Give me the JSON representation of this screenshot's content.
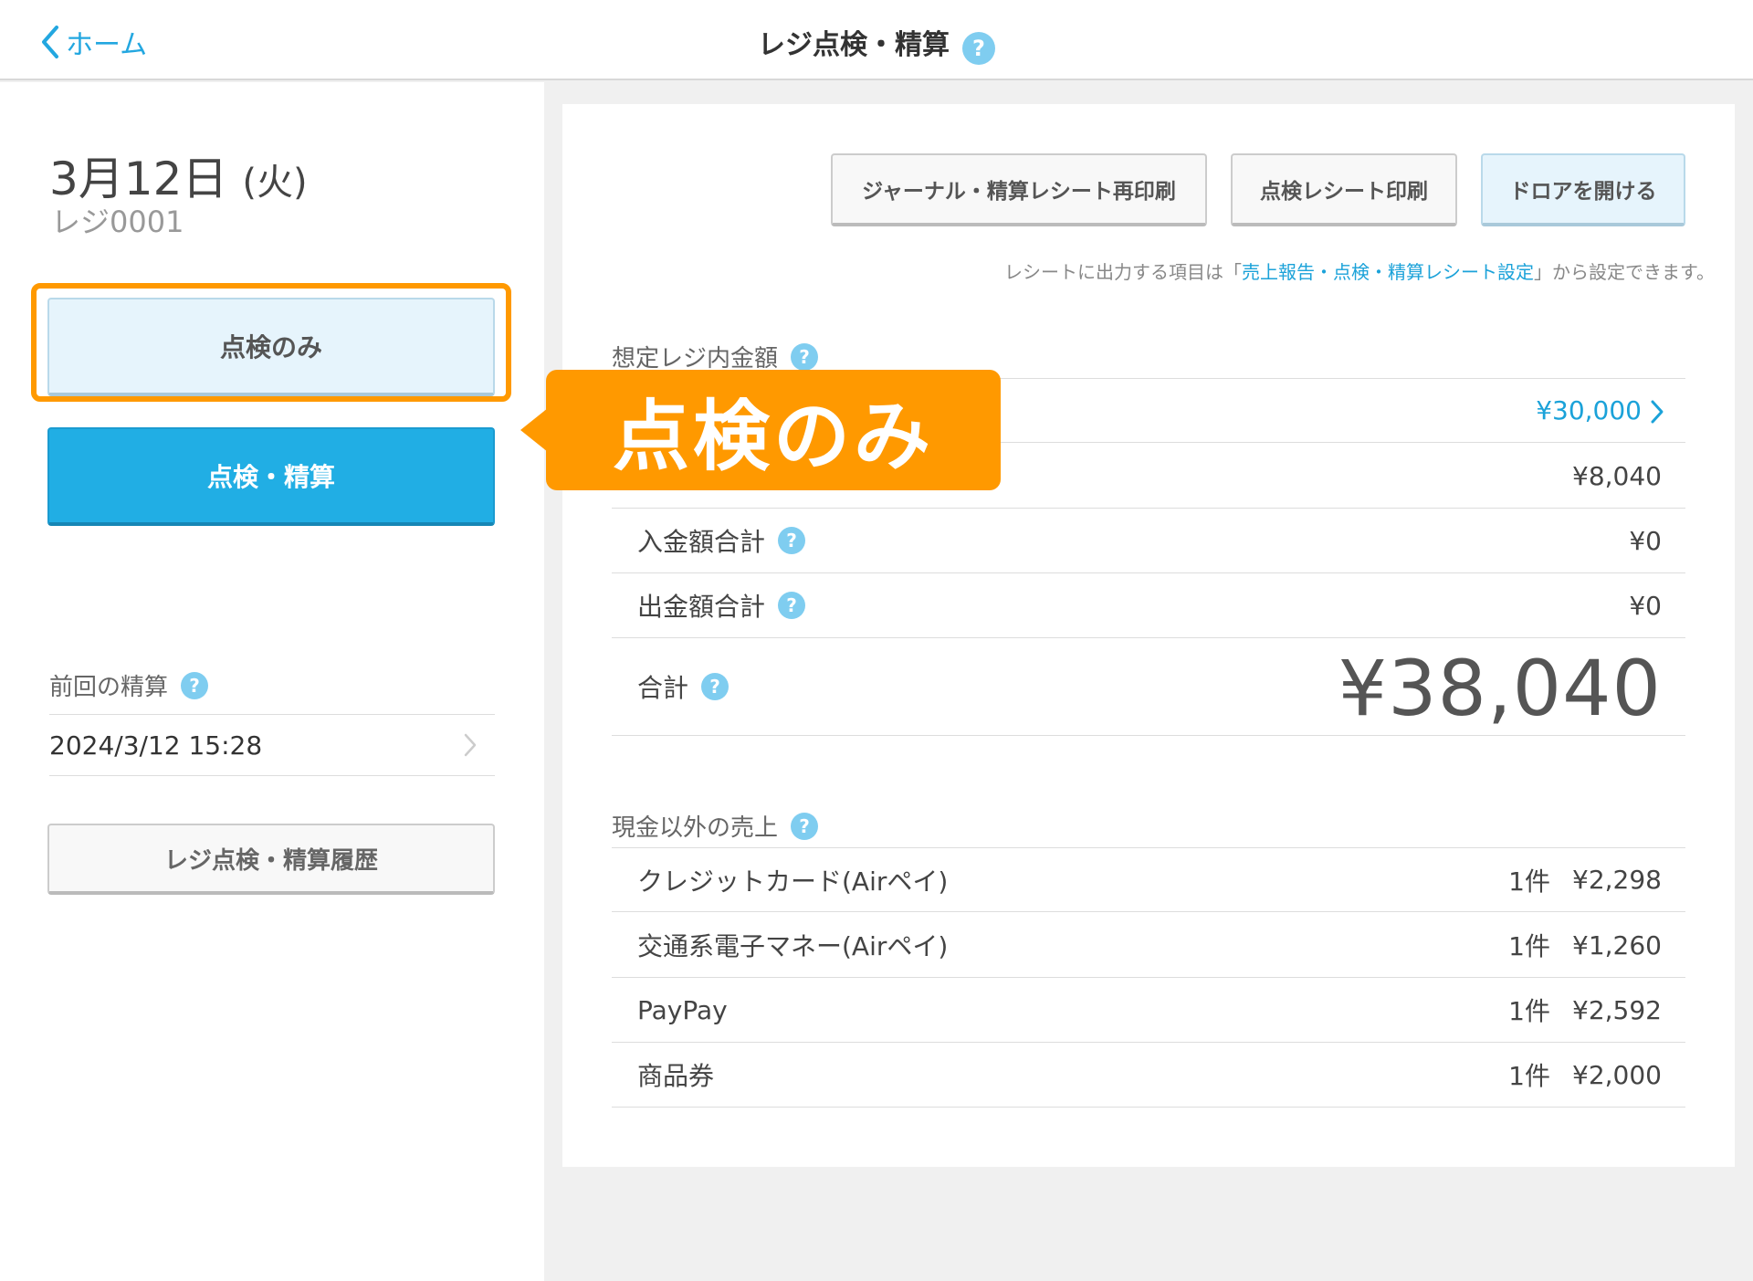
{
  "header": {
    "back_label": "ホーム",
    "title": "レジ点検・精算",
    "help": "?"
  },
  "sidebar": {
    "date_main": "3月12日",
    "date_day": "(火)",
    "register": "レジ0001",
    "check_only_label": "点検のみ",
    "check_settle_label": "点検・精算",
    "prev_settle_label": "前回の精算",
    "prev_settle_time": "2024/3/12 15:28",
    "history_label": "レジ点検・精算履歴"
  },
  "toolbar": {
    "reprint_label": "ジャーナル・精算レシート再印刷",
    "check_print_label": "点検レシート印刷",
    "drawer_label": "ドロアを開ける"
  },
  "note": {
    "before": "レシートに出力する項目は「",
    "link": "売上報告・点検・精算レシート設定",
    "after": "」から設定できます。"
  },
  "expected": {
    "label": "想定レジ内金額",
    "row1_amount": "¥30,000",
    "row2_amount": "¥8,040",
    "deposit_label": "入金額合計",
    "deposit_amount": "¥0",
    "withdraw_label": "出金額合計",
    "withdraw_amount": "¥0",
    "total_label": "合計",
    "total_amount": "¥38,040"
  },
  "non_cash": {
    "label": "現金以外の売上",
    "rows": [
      {
        "name": "クレジットカード(Airペイ)",
        "count": "1件",
        "amount": "¥2,298"
      },
      {
        "name": "交通系電子マネー(Airペイ)",
        "count": "1件",
        "amount": "¥1,260"
      },
      {
        "name": "PayPay",
        "count": "1件",
        "amount": "¥2,592"
      },
      {
        "name": "商品券",
        "count": "1件",
        "amount": "¥2,000"
      }
    ]
  },
  "callout": {
    "text": "点検のみ"
  },
  "colors": {
    "accent_blue": "#21aee4",
    "callout_orange": "#ff9900"
  }
}
